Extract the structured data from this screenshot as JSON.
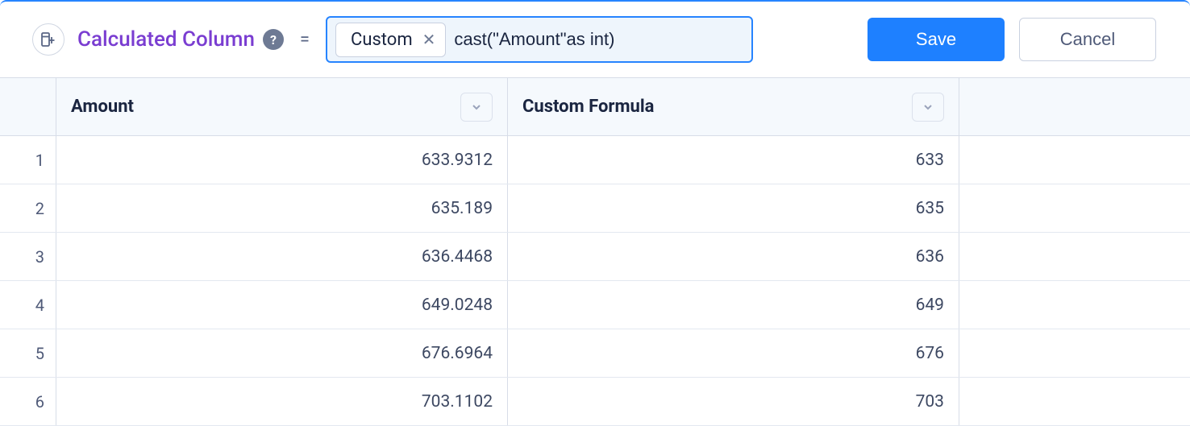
{
  "toolbar": {
    "title": "Calculated Column",
    "equals": "=",
    "chip_label": "Custom",
    "formula_value": "cast(\"Amount\"as int)",
    "save_label": "Save",
    "cancel_label": "Cancel"
  },
  "columns": {
    "amount_header": "Amount",
    "custom_header": "Custom Formula"
  },
  "rows": [
    {
      "n": "1",
      "amount": "633.9312",
      "custom": "633"
    },
    {
      "n": "2",
      "amount": "635.189",
      "custom": "635"
    },
    {
      "n": "3",
      "amount": "636.4468",
      "custom": "636"
    },
    {
      "n": "4",
      "amount": "649.0248",
      "custom": "649"
    },
    {
      "n": "5",
      "amount": "676.6964",
      "custom": "676"
    },
    {
      "n": "6",
      "amount": "703.1102",
      "custom": "703"
    }
  ]
}
